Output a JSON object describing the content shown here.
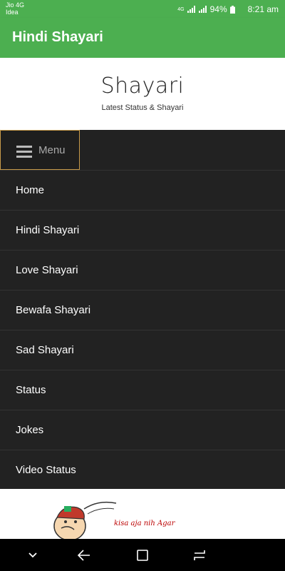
{
  "status_bar": {
    "carrier1": "Jio 4G",
    "carrier2": "Idea",
    "battery": "94%",
    "time": "8:21 am",
    "network_label": "4G"
  },
  "app_bar": {
    "title": "Hindi Shayari"
  },
  "site": {
    "title": "Shayari",
    "tagline": "Latest Status & Shayari"
  },
  "menu": {
    "toggle_label": "Menu",
    "items": [
      {
        "label": "Home"
      },
      {
        "label": "Hindi Shayari"
      },
      {
        "label": "Love Shayari"
      },
      {
        "label": "Bewafa Shayari"
      },
      {
        "label": "Sad Shayari"
      },
      {
        "label": "Status"
      },
      {
        "label": "Jokes"
      },
      {
        "label": "Video Status"
      }
    ]
  },
  "content": {
    "image_caption": "kisa aja nih Agar"
  },
  "colors": {
    "accent": "#4caf50",
    "nav_bg": "#222222",
    "toggle_border": "#c79a4a"
  },
  "nav_bar": {
    "icons": [
      "chevron-down-icon",
      "back-icon",
      "recents-icon",
      "switch-icon"
    ]
  }
}
